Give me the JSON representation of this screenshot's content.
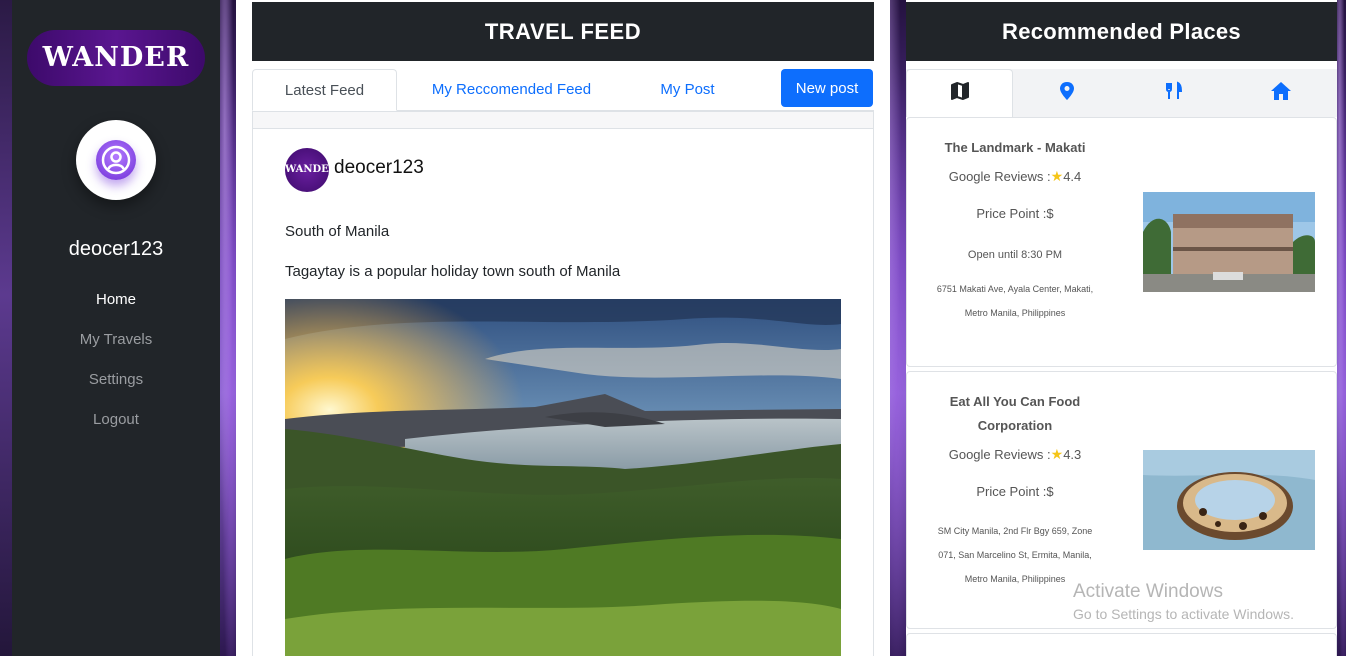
{
  "brand": {
    "name": "WANDER"
  },
  "sidebar": {
    "username": "deocer123",
    "items": [
      {
        "label": "Home",
        "active": true
      },
      {
        "label": "My Travels"
      },
      {
        "label": "Settings"
      },
      {
        "label": "Logout"
      }
    ]
  },
  "feed": {
    "title": "TRAVEL FEED",
    "tabs": [
      {
        "label": "Latest Feed",
        "active": true
      },
      {
        "label": "My Reccomended Feed"
      },
      {
        "label": "My Post"
      }
    ],
    "new_post_label": "New post",
    "post": {
      "avatar_text": "WANDER",
      "username": "deocer123",
      "title": "South of Manila",
      "text": "Tagaytay is a popular holiday town south of Manila"
    }
  },
  "recommended": {
    "title": "Recommended Places",
    "tabs": [
      {
        "icon": "map-icon",
        "active": true
      },
      {
        "icon": "location-pin-icon"
      },
      {
        "icon": "restaurant-icon"
      },
      {
        "icon": "home-icon"
      }
    ],
    "places": [
      {
        "name": "The Landmark - Makati",
        "reviews_label": "Google Reviews :",
        "rating": "4.4",
        "price": "Price Point :$",
        "hours": "Open until 8:30 PM",
        "address_line1": "6751 Makati Ave, Ayala Center, Makati,",
        "address_line2": "Metro Manila, Philippines"
      },
      {
        "name_line1": "Eat All You Can Food",
        "name_line2": "Corporation",
        "reviews_label": "Google Reviews :",
        "rating": "4.3",
        "price": "Price Point :$",
        "address_line1": "SM City Manila, 2nd Flr Bgy 659, Zone",
        "address_line2": "071, San Marcelino St, Ermita, Manila,",
        "address_line3": "Metro Manila, Philippines"
      }
    ]
  },
  "watermark": {
    "line1": "Activate Windows",
    "line2": "Go to Settings to activate Windows."
  },
  "colors": {
    "sidebar_bg": "#212529",
    "brand_purple": "#4b0f80",
    "primary": "#0d6efd",
    "header_bg": "#212529"
  }
}
